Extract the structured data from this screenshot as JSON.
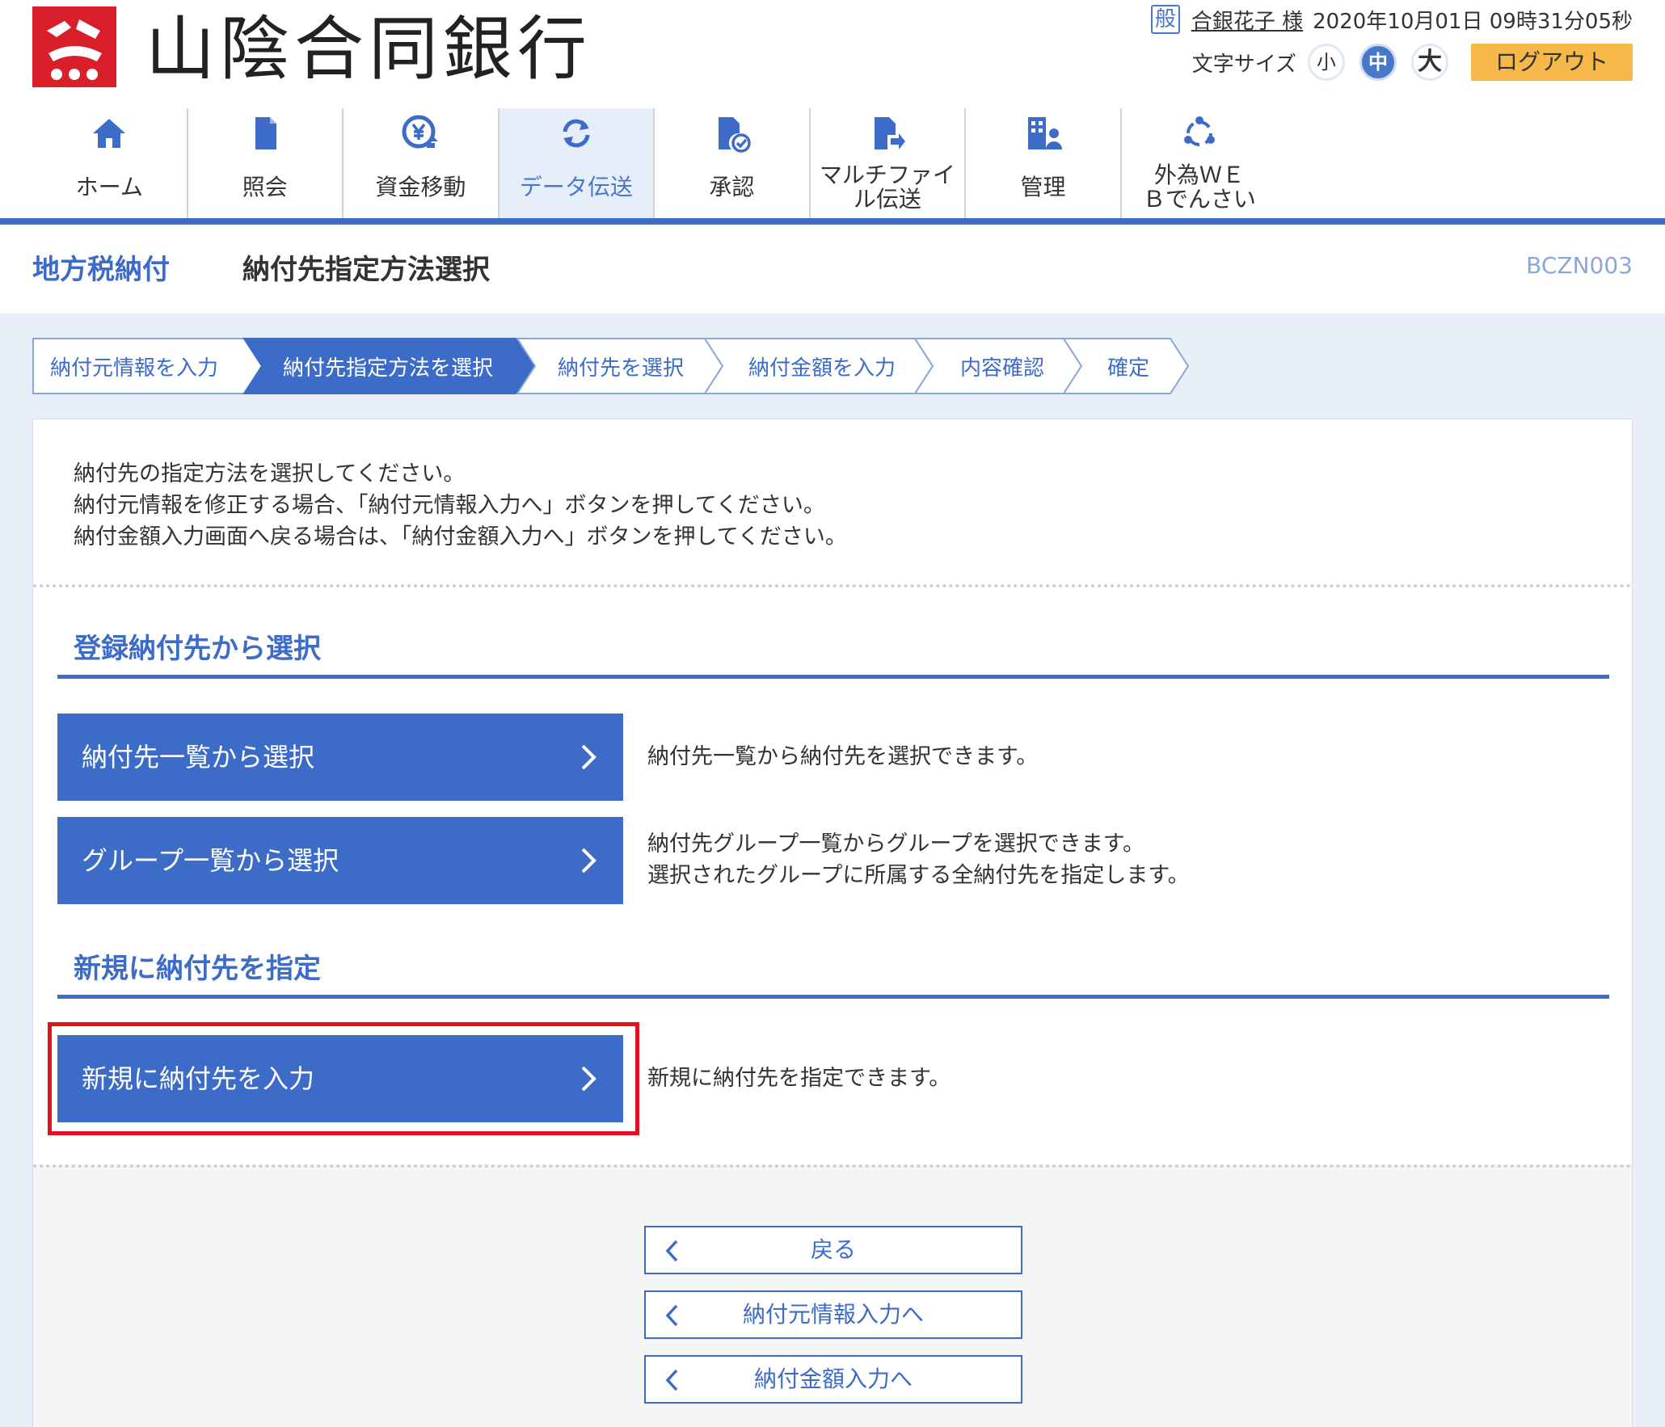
{
  "header": {
    "bank_name": "山陰合同銀行",
    "user_badge": "般",
    "user_name": "合銀花子 様",
    "datetime": "2020年10月01日 09時31分05秒",
    "font_size_label": "文字サイズ",
    "font_small": "小",
    "font_medium": "中",
    "font_large": "大",
    "logout_label": "ログアウト"
  },
  "nav": {
    "items": [
      {
        "label": "ホーム",
        "icon": "home-icon"
      },
      {
        "label": "照会",
        "icon": "document-icon"
      },
      {
        "label": "資金移動",
        "icon": "yen-transfer-icon"
      },
      {
        "label": "データ伝送",
        "icon": "refresh-icon"
      },
      {
        "label": "承認",
        "icon": "approve-icon"
      },
      {
        "label": "マルチファイル伝送",
        "icon": "file-send-icon"
      },
      {
        "label": "管理",
        "icon": "admin-icon"
      },
      {
        "label": "外為ＷＥＢでんさい",
        "icon": "network-icon"
      }
    ],
    "active_index": 3
  },
  "title": {
    "main": "地方税納付",
    "sub": "納付先指定方法選択",
    "code": "BCZN003"
  },
  "steps": [
    "納付元情報を入力",
    "納付先指定方法を選択",
    "納付先を選択",
    "納付金額を入力",
    "内容確認",
    "確定"
  ],
  "instructions": [
    "納付先の指定方法を選択してください。",
    "納付元情報を修正する場合、「納付元情報入力へ」ボタンを押してください。",
    "納付金額入力画面へ戻る場合は、「納付金額入力へ」ボタンを押してください。"
  ],
  "section_registered": {
    "heading": "登録納付先から選択",
    "btn_list": "納付先一覧から選択",
    "desc_list": "納付先一覧から納付先を選択できます。",
    "btn_group": "グループ一覧から選択",
    "desc_group_1": "納付先グループ一覧からグループを選択できます。",
    "desc_group_2": "選択されたグループに所属する全納付先を指定します。"
  },
  "section_new": {
    "heading": "新規に納付先を指定",
    "btn_new": "新規に納付先を入力",
    "desc_new": "新規に納付先を指定できます。"
  },
  "footer_buttons": {
    "back": "戻る",
    "to_source": "納付元情報入力へ",
    "to_amount": "納付金額入力へ"
  },
  "colors": {
    "primary": "#3d6cc8",
    "logout": "#f7b84a",
    "highlight": "#e0121d",
    "logo": "#d9202a"
  }
}
